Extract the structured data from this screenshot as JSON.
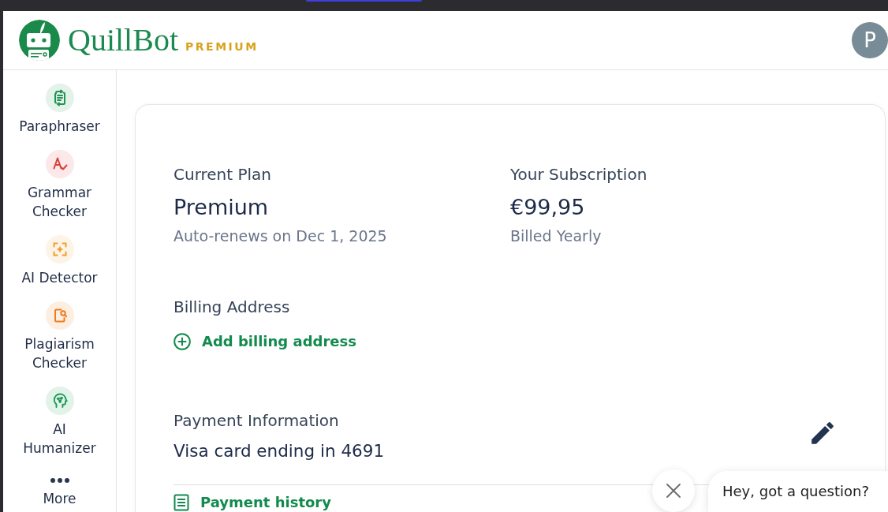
{
  "header": {
    "logo": {
      "wordmark": "QuillBot",
      "badge": "PREMIUM"
    },
    "avatar": {
      "initial": "P"
    }
  },
  "sidebar": {
    "items": [
      {
        "kind": "paraphraser",
        "label": "Paraphraser",
        "selected": false
      },
      {
        "kind": "grammar",
        "label": "Grammar Checker",
        "selected": false
      },
      {
        "kind": "detector",
        "label": "AI Detector",
        "selected": false
      },
      {
        "kind": "plagiarism",
        "label": "Plagiarism Checker",
        "selected": false
      },
      {
        "kind": "humanizer",
        "label": "AI Humanizer",
        "selected": false
      },
      {
        "kind": "more",
        "label": "More",
        "selected": false
      }
    ]
  },
  "account": {
    "plan": {
      "label": "Current Plan",
      "value": "Premium",
      "note": "Auto-renews on Dec 1, 2025"
    },
    "subscription": {
      "label": "Your Subscription",
      "value": "€99,95",
      "note": "Billed Yearly"
    },
    "billing_address": {
      "label": "Billing Address",
      "action": "Add billing address"
    },
    "payment_information": {
      "label": "Payment Information",
      "value": "Visa card ending in 4691"
    },
    "payment_history": {
      "label": "Payment history"
    }
  },
  "chat_widget": {
    "message": "Hey, got a question?"
  }
}
